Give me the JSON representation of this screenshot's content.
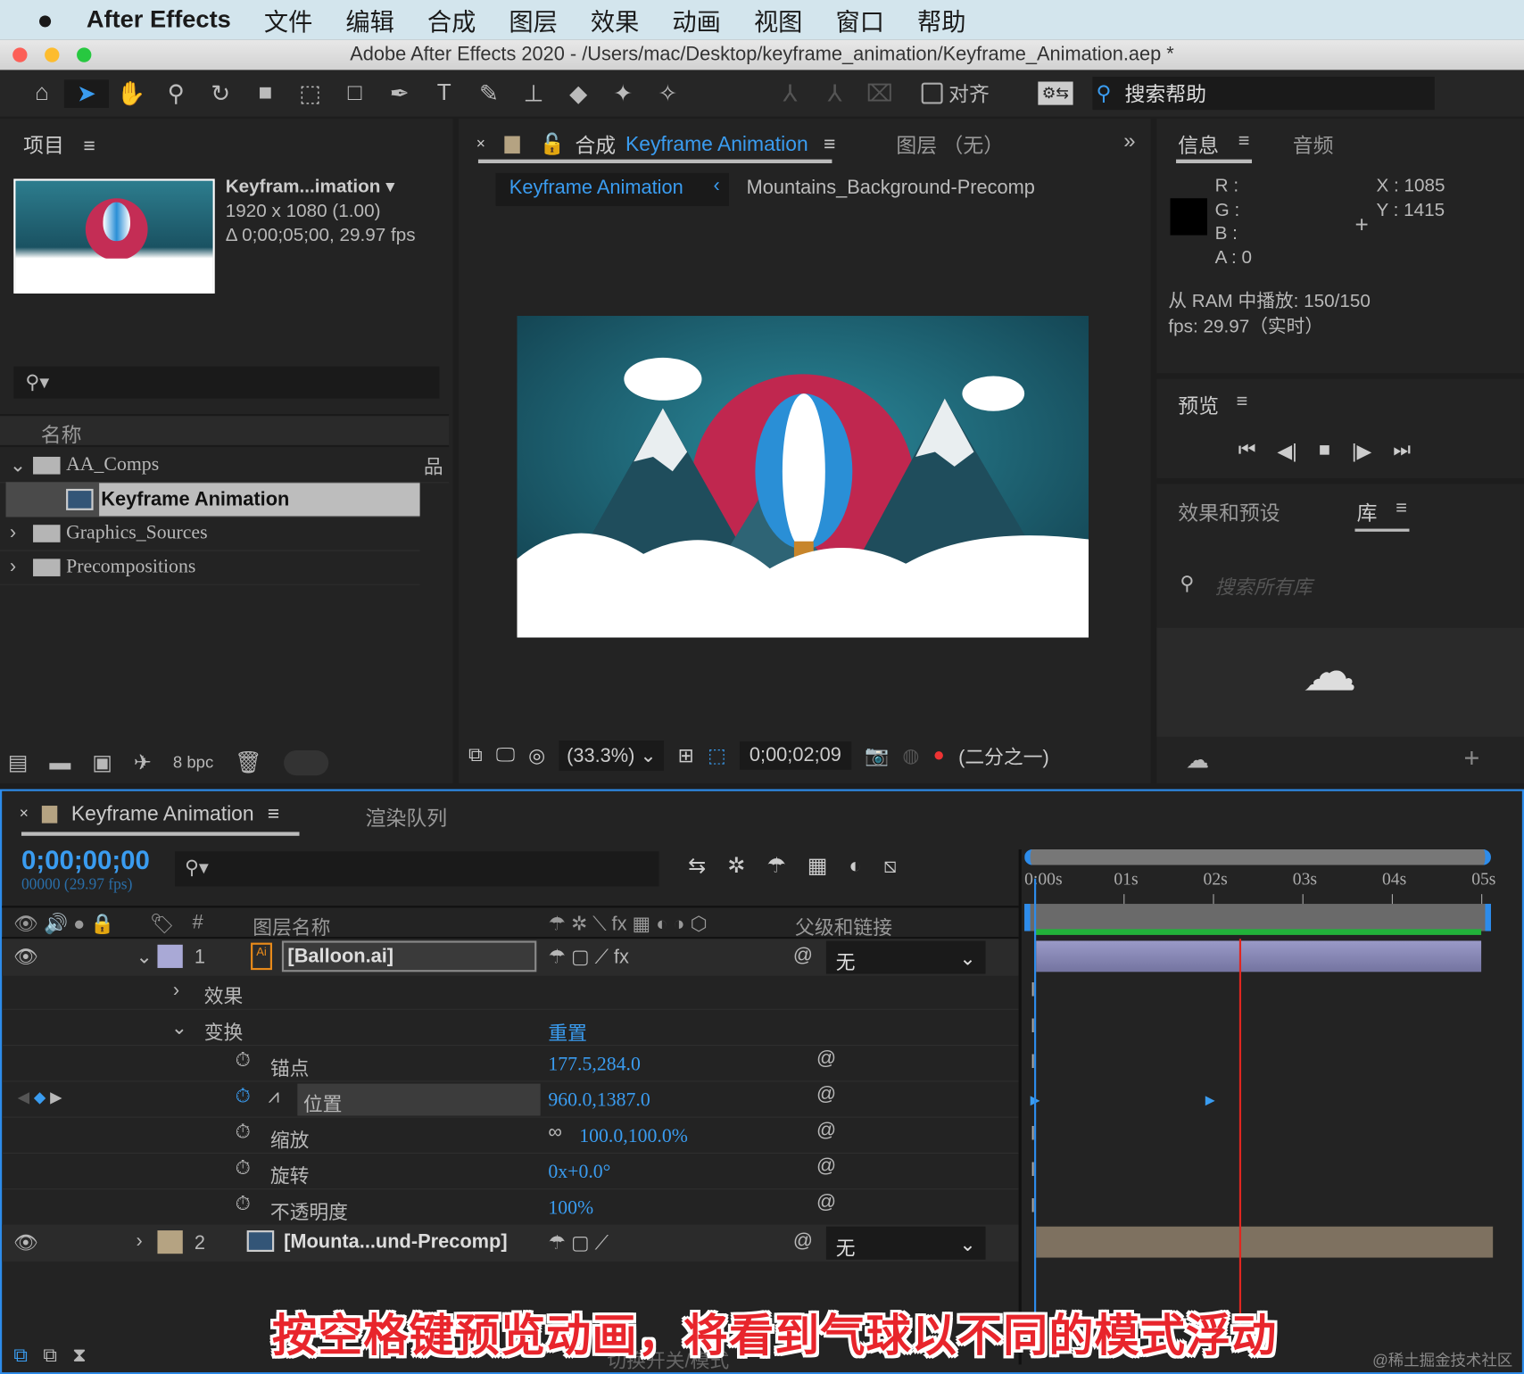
{
  "menubar": {
    "app": "After Effects",
    "items": [
      "文件",
      "编辑",
      "合成",
      "图层",
      "效果",
      "动画",
      "视图",
      "窗口",
      "帮助"
    ]
  },
  "window": {
    "title": "Adobe After Effects 2020 - /Users/mac/Desktop/keyframe_animation/Keyframe_Animation.aep *"
  },
  "toolbar": {
    "align_label": "对齐",
    "search_help": "搜索帮助"
  },
  "project": {
    "tab": "项目",
    "comp_name": "Keyfram...imation",
    "resolution": "1920 x 1080 (1.00)",
    "duration": "Δ 0;00;05;00, 29.97 fps",
    "col_name": "名称",
    "items": [
      {
        "name": "AA_Comps",
        "type": "folder",
        "expanded": true
      },
      {
        "name": "Keyframe Animation",
        "type": "comp",
        "selected": true
      },
      {
        "name": "Graphics_Sources",
        "type": "folder"
      },
      {
        "name": "Precompositions",
        "type": "folder"
      }
    ],
    "bpc": "8 bpc"
  },
  "comp": {
    "tab_prefix": "合成",
    "tab_name": "Keyframe Animation",
    "layer_tab": "图层 （无）",
    "breadcrumb": [
      "Keyframe Animation",
      "Mountains_Background-Precomp"
    ],
    "zoom": "(33.3%)",
    "timecode": "0;00;02;09",
    "resolution": "(二分之一)"
  },
  "info": {
    "tab": "信息",
    "audio_tab": "音频",
    "R": "R :",
    "G": "G :",
    "B": "B :",
    "A": "A :  0",
    "X": "X : 1085",
    "Y": "Y : 1415",
    "ram": "从 RAM 中播放: 150/150",
    "fps": "fps: 29.97（实时）",
    "swatch_color": "#000000"
  },
  "preview": {
    "tab": "预览"
  },
  "effects": {
    "tab": "效果和预设",
    "lib_tab": "库",
    "search_placeholder": "搜索所有库"
  },
  "timeline": {
    "tab": "Keyframe Animation",
    "render_tab": "渲染队列",
    "timecode": "0;00;00;00",
    "frames": "00000 (29.97 fps)",
    "col_layer_name": "图层名称",
    "col_num": "#",
    "col_parent": "父级和链接",
    "ruler": [
      "0:00s",
      "01s",
      "02s",
      "03s",
      "04s",
      "05s"
    ],
    "playhead_percent": 0,
    "current_time_indicator_s": 2.3,
    "layers": [
      {
        "num": "1",
        "name": "[Balloon.ai]",
        "parent": "无",
        "color": "#a9a9d6"
      },
      {
        "num": "2",
        "name": "[Mounta...und-Precomp]",
        "parent": "无",
        "color": "#b5a382"
      }
    ],
    "props": {
      "effects": "效果",
      "transform": "变换",
      "reset": "重置",
      "anchor": "锚点",
      "anchor_val": "177.5,284.0",
      "position": "位置",
      "position_val": "960.0,1387.0",
      "scale": "缩放",
      "scale_val": "100.0,100.0%",
      "rotation": "旋转",
      "rotation_val": "0x+0.0°",
      "opacity": "不透明度",
      "opacity_val": "100%"
    },
    "footer": "切换开关/模式"
  },
  "subtitle": "按空格键预览动画，将看到气球以不同的模式浮动",
  "watermark": "@稀土掘金技术社区",
  "colors": {
    "accent": "#3a9cf0",
    "cti": "#e0261f",
    "workarea": "#22b33a"
  }
}
